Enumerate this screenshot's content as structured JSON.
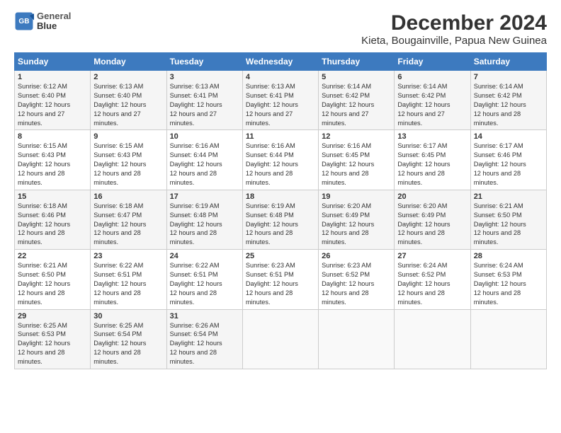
{
  "header": {
    "logo_line1": "General",
    "logo_line2": "Blue",
    "title": "December 2024",
    "subtitle": "Kieta, Bougainville, Papua New Guinea"
  },
  "weekdays": [
    "Sunday",
    "Monday",
    "Tuesday",
    "Wednesday",
    "Thursday",
    "Friday",
    "Saturday"
  ],
  "weeks": [
    [
      {
        "day": "1",
        "sr": "6:12 AM",
        "ss": "6:40 PM",
        "dl": "12 hours and 27 minutes."
      },
      {
        "day": "2",
        "sr": "6:13 AM",
        "ss": "6:40 PM",
        "dl": "12 hours and 27 minutes."
      },
      {
        "day": "3",
        "sr": "6:13 AM",
        "ss": "6:41 PM",
        "dl": "12 hours and 27 minutes."
      },
      {
        "day": "4",
        "sr": "6:13 AM",
        "ss": "6:41 PM",
        "dl": "12 hours and 27 minutes."
      },
      {
        "day": "5",
        "sr": "6:14 AM",
        "ss": "6:42 PM",
        "dl": "12 hours and 27 minutes."
      },
      {
        "day": "6",
        "sr": "6:14 AM",
        "ss": "6:42 PM",
        "dl": "12 hours and 27 minutes."
      },
      {
        "day": "7",
        "sr": "6:14 AM",
        "ss": "6:42 PM",
        "dl": "12 hours and 28 minutes."
      }
    ],
    [
      {
        "day": "8",
        "sr": "6:15 AM",
        "ss": "6:43 PM",
        "dl": "12 hours and 28 minutes."
      },
      {
        "day": "9",
        "sr": "6:15 AM",
        "ss": "6:43 PM",
        "dl": "12 hours and 28 minutes."
      },
      {
        "day": "10",
        "sr": "6:16 AM",
        "ss": "6:44 PM",
        "dl": "12 hours and 28 minutes."
      },
      {
        "day": "11",
        "sr": "6:16 AM",
        "ss": "6:44 PM",
        "dl": "12 hours and 28 minutes."
      },
      {
        "day": "12",
        "sr": "6:16 AM",
        "ss": "6:45 PM",
        "dl": "12 hours and 28 minutes."
      },
      {
        "day": "13",
        "sr": "6:17 AM",
        "ss": "6:45 PM",
        "dl": "12 hours and 28 minutes."
      },
      {
        "day": "14",
        "sr": "6:17 AM",
        "ss": "6:46 PM",
        "dl": "12 hours and 28 minutes."
      }
    ],
    [
      {
        "day": "15",
        "sr": "6:18 AM",
        "ss": "6:46 PM",
        "dl": "12 hours and 28 minutes."
      },
      {
        "day": "16",
        "sr": "6:18 AM",
        "ss": "6:47 PM",
        "dl": "12 hours and 28 minutes."
      },
      {
        "day": "17",
        "sr": "6:19 AM",
        "ss": "6:48 PM",
        "dl": "12 hours and 28 minutes."
      },
      {
        "day": "18",
        "sr": "6:19 AM",
        "ss": "6:48 PM",
        "dl": "12 hours and 28 minutes."
      },
      {
        "day": "19",
        "sr": "6:20 AM",
        "ss": "6:49 PM",
        "dl": "12 hours and 28 minutes."
      },
      {
        "day": "20",
        "sr": "6:20 AM",
        "ss": "6:49 PM",
        "dl": "12 hours and 28 minutes."
      },
      {
        "day": "21",
        "sr": "6:21 AM",
        "ss": "6:50 PM",
        "dl": "12 hours and 28 minutes."
      }
    ],
    [
      {
        "day": "22",
        "sr": "6:21 AM",
        "ss": "6:50 PM",
        "dl": "12 hours and 28 minutes."
      },
      {
        "day": "23",
        "sr": "6:22 AM",
        "ss": "6:51 PM",
        "dl": "12 hours and 28 minutes."
      },
      {
        "day": "24",
        "sr": "6:22 AM",
        "ss": "6:51 PM",
        "dl": "12 hours and 28 minutes."
      },
      {
        "day": "25",
        "sr": "6:23 AM",
        "ss": "6:51 PM",
        "dl": "12 hours and 28 minutes."
      },
      {
        "day": "26",
        "sr": "6:23 AM",
        "ss": "6:52 PM",
        "dl": "12 hours and 28 minutes."
      },
      {
        "day": "27",
        "sr": "6:24 AM",
        "ss": "6:52 PM",
        "dl": "12 hours and 28 minutes."
      },
      {
        "day": "28",
        "sr": "6:24 AM",
        "ss": "6:53 PM",
        "dl": "12 hours and 28 minutes."
      }
    ],
    [
      {
        "day": "29",
        "sr": "6:25 AM",
        "ss": "6:53 PM",
        "dl": "12 hours and 28 minutes."
      },
      {
        "day": "30",
        "sr": "6:25 AM",
        "ss": "6:54 PM",
        "dl": "12 hours and 28 minutes."
      },
      {
        "day": "31",
        "sr": "6:26 AM",
        "ss": "6:54 PM",
        "dl": "12 hours and 28 minutes."
      },
      null,
      null,
      null,
      null
    ]
  ],
  "labels": {
    "sunrise": "Sunrise:",
    "sunset": "Sunset:",
    "daylight": "Daylight:"
  }
}
